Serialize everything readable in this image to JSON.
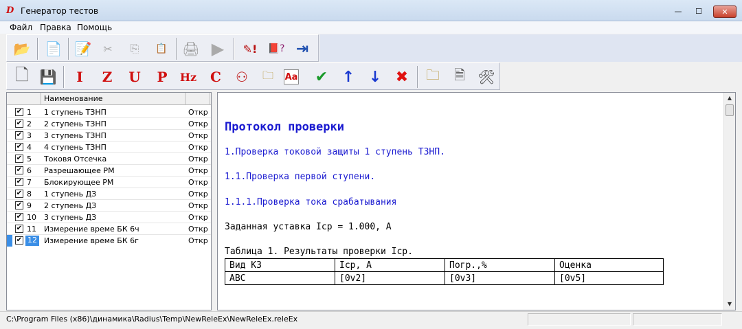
{
  "window": {
    "title": "Генератор тестов",
    "app_icon_glyph": "D",
    "close_glyph": "✕",
    "min_glyph": "—",
    "max_glyph": "☐"
  },
  "menu": [
    {
      "label": "Файл"
    },
    {
      "label": "Правка"
    },
    {
      "label": "Помощь"
    }
  ],
  "toolbar1": {
    "buttons": [
      {
        "name": "open-folder-icon",
        "glyph": "📂"
      },
      {
        "name": "document-icon",
        "glyph": "📄"
      },
      {
        "name": "edit-document-icon",
        "glyph": "📝"
      },
      {
        "name": "cut-icon",
        "glyph": "✂"
      },
      {
        "name": "copy-icon",
        "glyph": "⎘"
      },
      {
        "name": "paste-icon",
        "glyph": "📋"
      },
      {
        "name": "printer-icon",
        "glyph": "🖨"
      },
      {
        "name": "play-icon",
        "glyph": "▶"
      },
      {
        "name": "pencil-warning-icon",
        "glyph": "✎!"
      },
      {
        "name": "help-book-icon",
        "glyph": "📕?"
      },
      {
        "name": "exit-door-icon",
        "glyph": "⇥"
      }
    ]
  },
  "toolbar2": {
    "buttons": [
      {
        "name": "new-file-icon",
        "glyph": "🗋"
      },
      {
        "name": "save-icon",
        "glyph": "💾"
      },
      {
        "name": "add-i-icon",
        "glyph": "I"
      },
      {
        "name": "add-z-icon",
        "glyph": "Z"
      },
      {
        "name": "add-u-icon",
        "glyph": "U"
      },
      {
        "name": "add-p-icon",
        "glyph": "P"
      },
      {
        "name": "add-hz-icon",
        "glyph": "Hz"
      },
      {
        "name": "add-c-icon",
        "glyph": "C"
      },
      {
        "name": "add-network-icon",
        "glyph": "⚇"
      },
      {
        "name": "add-folder-icon",
        "glyph": "🗀"
      },
      {
        "name": "add-text-icon",
        "glyph": "Aa"
      },
      {
        "name": "check-icon",
        "glyph": "✔"
      },
      {
        "name": "move-up-icon",
        "glyph": "↑"
      },
      {
        "name": "move-down-icon",
        "glyph": "↓"
      },
      {
        "name": "delete-icon",
        "glyph": "✖"
      },
      {
        "name": "open-file-icon",
        "glyph": "🗀"
      },
      {
        "name": "save-file-icon",
        "glyph": "🗎"
      },
      {
        "name": "tools-icon",
        "glyph": "🛠"
      }
    ]
  },
  "grid": {
    "header": {
      "name_col": "Наименование"
    },
    "rows": [
      {
        "num": "1",
        "name": "1 ступень ТЗНП",
        "status": "Откр",
        "checked": "✔"
      },
      {
        "num": "2",
        "name": "2 ступень ТЗНП",
        "status": "Откр",
        "checked": "✔"
      },
      {
        "num": "3",
        "name": "3 ступень ТЗНП",
        "status": "Откр",
        "checked": "✔"
      },
      {
        "num": "4",
        "name": "4 ступень ТЗНП",
        "status": "Откр",
        "checked": "✔"
      },
      {
        "num": "5",
        "name": "Токовя Отсечка",
        "status": "Откр",
        "checked": "✔"
      },
      {
        "num": "6",
        "name": "Разрешающее РМ",
        "status": "Откр",
        "checked": "✔"
      },
      {
        "num": "7",
        "name": "Блокирующее РМ",
        "status": "Откр",
        "checked": "✔"
      },
      {
        "num": "8",
        "name": "1 ступень ДЗ",
        "status": "Откр",
        "checked": "✔"
      },
      {
        "num": "9",
        "name": "2 ступень ДЗ",
        "status": "Откр",
        "checked": "✔"
      },
      {
        "num": "10",
        "name": "3 ступень ДЗ",
        "status": "Откр",
        "checked": "✔"
      },
      {
        "num": "11",
        "name": "Измерение време БК 6ч",
        "status": "Откр",
        "checked": "✔"
      },
      {
        "num": "12",
        "name": "Измерение време БК 6г",
        "status": "Откр",
        "checked": "✔"
      }
    ],
    "selected_row": "12"
  },
  "document": {
    "title": "Протокол проверки",
    "h1": "1.Проверка токовой защиты 1 ступень ТЗНП.",
    "h2": "1.1.Проверка первой ступени.",
    "h3": "1.1.1.Проверка тока срабатывания",
    "setting": "Заданная уставка Icp = 1.000, A",
    "table_caption": "Таблица 1. Результаты проверки Icp.",
    "table": {
      "headers": [
        "Вид КЗ",
        "Icp, A",
        "Погр.,%",
        "Оценка"
      ],
      "row": [
        "ABC",
        "[0v2]",
        "[0v3]",
        "[0v5]"
      ]
    }
  },
  "statusbar": {
    "path": "C:\\Program Files (x86)\\динамика\\Radius\\Temp\\NewReleEx\\NewReleEx.releEx"
  }
}
